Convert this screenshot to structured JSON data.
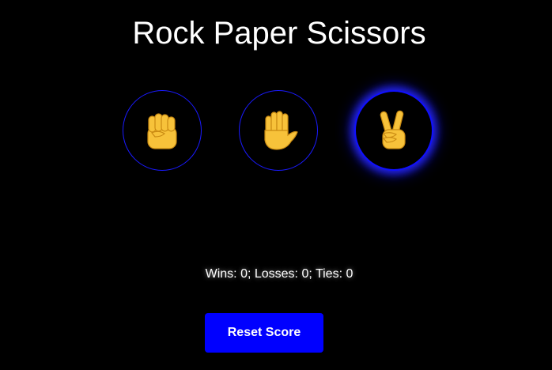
{
  "game": {
    "title": "Rock Paper Scissors"
  },
  "choices": [
    {
      "name": "rock",
      "icon": "raised-fist-icon",
      "selected": false
    },
    {
      "name": "paper",
      "icon": "raised-hand-icon",
      "selected": false
    },
    {
      "name": "scissors",
      "icon": "victory-hand-icon",
      "selected": true
    }
  ],
  "scoreboard": {
    "text": "Wins: 0; Losses: 0; Ties: 0",
    "wins": 0,
    "losses": 0,
    "ties": 0
  },
  "controls": {
    "reset_label": "Reset Score"
  },
  "colors": {
    "background": "#000000",
    "accent": "#0000ff",
    "skin": "#f7c23a"
  }
}
